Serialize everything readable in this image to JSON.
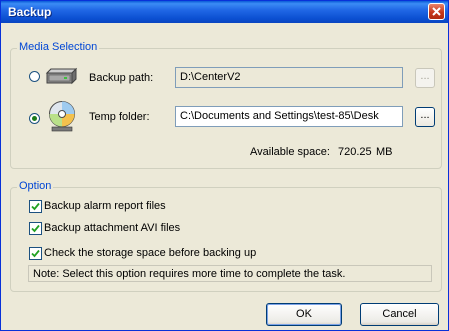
{
  "window": {
    "title": "Backup"
  },
  "media_selection": {
    "group_title": "Media Selection",
    "backup_path": {
      "label": "Backup path:",
      "value": "D:\\CenterV2",
      "browse_label": "...",
      "selected": false
    },
    "temp_folder": {
      "label": "Temp folder:",
      "value": "C:\\Documents and Settings\\test-85\\Desk",
      "browse_label": "...",
      "selected": true
    },
    "available_space_label": "Available space:",
    "available_space_value": "720.25",
    "available_space_unit": "MB"
  },
  "option": {
    "group_title": "Option",
    "checkboxes": [
      {
        "label": "Backup alarm report files",
        "checked": true
      },
      {
        "label": "Backup attachment AVI files",
        "checked": true
      },
      {
        "label": "Check the storage space before backing up",
        "checked": true
      }
    ],
    "note": "Note: Select this option requires more time to complete the task."
  },
  "buttons": {
    "ok": "OK",
    "cancel": "Cancel"
  },
  "colors": {
    "title_bar": "#0b4fd1",
    "group_title": "#0046d5",
    "check_mark": "#21a121",
    "close_button": "#c6371b"
  }
}
